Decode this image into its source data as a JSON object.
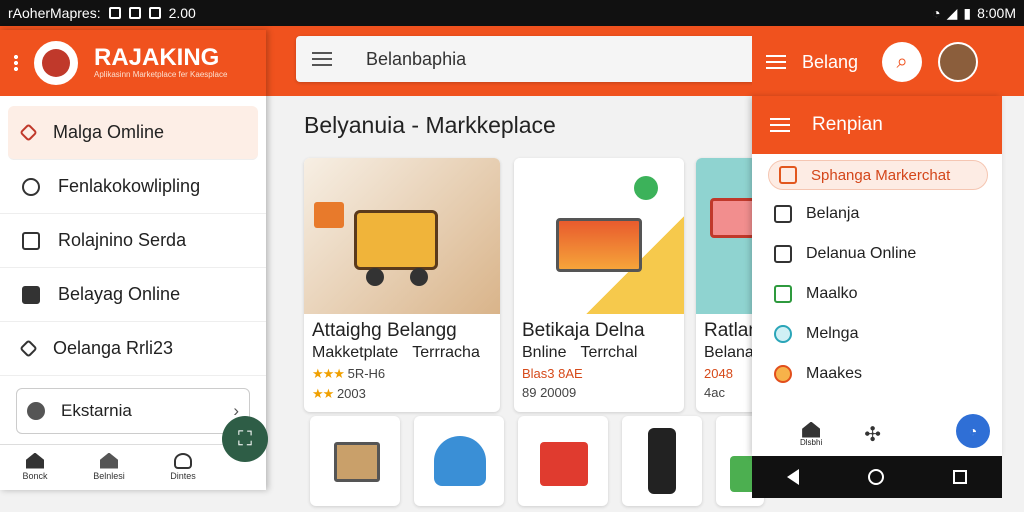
{
  "status_bar": {
    "left_text": "rAoherMapres:",
    "time_left": "2.00",
    "time_right": "8:00M"
  },
  "search": {
    "placeholder": "Belanbaphia"
  },
  "page_title": "Belyanuia - Markkeplace",
  "products": [
    {
      "name": "Attaighg Belangg",
      "sub1": "Makketplate",
      "sub2": "Terrracha",
      "rating": "5R-H6",
      "price": "2003",
      "accent": "#e8a53a"
    },
    {
      "name": "Betikaja Delna",
      "sub1": "Bnline",
      "sub2": "Terrchal",
      "rating": "Blas3 8AE",
      "price": "89 20009",
      "accent": "#f6c94c"
    },
    {
      "name": "Ratlan",
      "sub1": "Belana",
      "sub2": "",
      "rating": "2048",
      "price": "4ac",
      "accent": "#8fd3d0"
    }
  ],
  "drawer": {
    "brand": "RAJAKING",
    "tagline": "Aplikasinn Marketplace fer Kaesplace",
    "items": [
      {
        "label": "Malga Omline",
        "icon": "tag-icon"
      },
      {
        "label": "Fenlakokowlipling",
        "icon": "check-circle-icon"
      },
      {
        "label": "Rolajnino Serda",
        "icon": "box-icon"
      },
      {
        "label": "Belayag Online",
        "icon": "checkbox-icon"
      },
      {
        "label": "Oelanga Rrli23",
        "icon": "diamond-icon"
      }
    ],
    "field_label": "Ekstarnia",
    "bottom_nav": [
      {
        "label": "Bonck",
        "icon": "home-icon"
      },
      {
        "label": "Belnlesi",
        "icon": "store-icon"
      },
      {
        "label": "Dintes",
        "icon": "person-icon"
      }
    ]
  },
  "right_panel": {
    "header_title": "Belang",
    "panel_title": "Renpian",
    "items": [
      {
        "label": "Sphanga Markerchat",
        "icon": "bag-icon",
        "style": "orange"
      },
      {
        "label": "Belanja",
        "icon": "book-icon",
        "style": ""
      },
      {
        "label": "Delanua Online",
        "icon": "dollar-icon",
        "style": ""
      },
      {
        "label": "Maalko",
        "icon": "chart-icon",
        "style": "green"
      },
      {
        "label": "Melnga",
        "icon": "compass-icon",
        "style": "teal"
      },
      {
        "label": "Maakes",
        "icon": "store-badge-icon",
        "style": "red"
      }
    ],
    "bottom_label": "Dlsbhi"
  },
  "colors": {
    "brand_orange": "#f0521e",
    "fab_green": "#2e5d46",
    "fab_blue": "#2f6fd6"
  }
}
